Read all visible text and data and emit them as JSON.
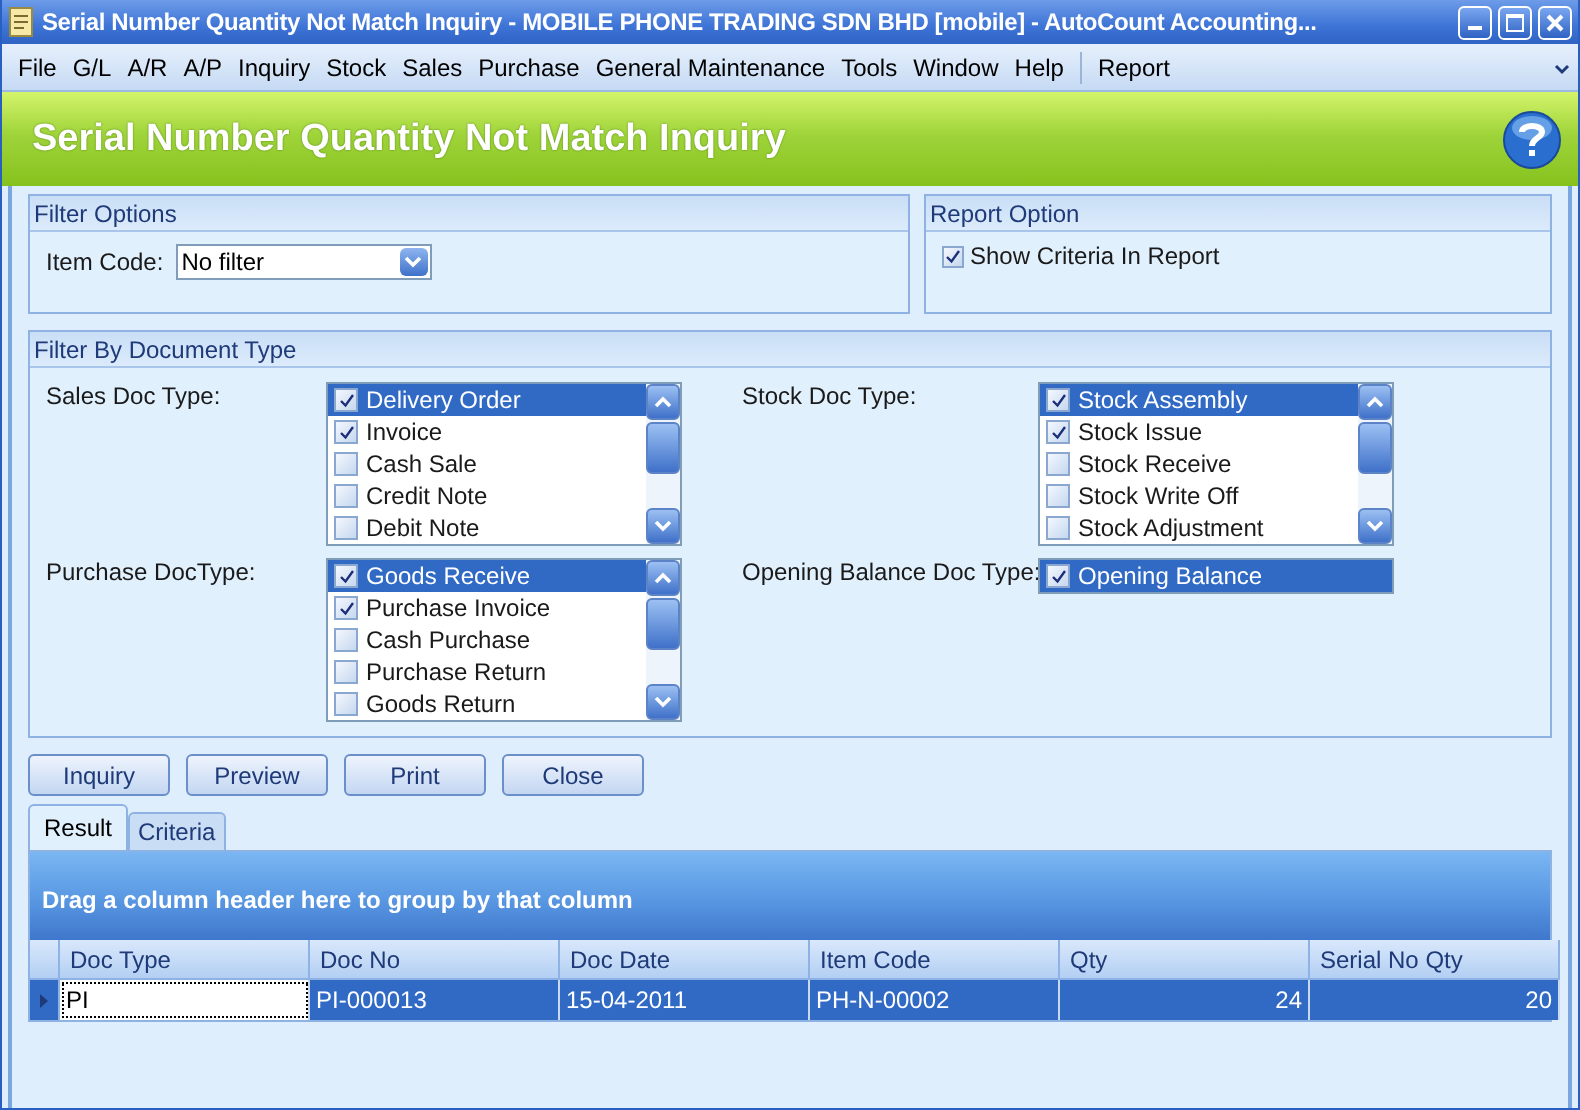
{
  "window": {
    "title": "Serial Number Quantity Not Match Inquiry - MOBILE PHONE TRADING SDN BHD [mobile] - AutoCount Accounting..."
  },
  "menu": [
    {
      "label": "File"
    },
    {
      "label": "G/L"
    },
    {
      "label": "A/R"
    },
    {
      "label": "A/P"
    },
    {
      "label": "Inquiry"
    },
    {
      "label": "Stock"
    },
    {
      "label": "Sales"
    },
    {
      "label": "Purchase"
    },
    {
      "label": "General Maintenance"
    },
    {
      "label": "Tools"
    },
    {
      "label": "Window"
    },
    {
      "label": "Help"
    },
    {
      "label": "Report"
    }
  ],
  "header": {
    "title": "Serial Number Quantity Not Match Inquiry"
  },
  "filter_options": {
    "title": "Filter Options",
    "item_code": {
      "label": "Item Code:",
      "value": "No filter"
    }
  },
  "report_option": {
    "title": "Report Option",
    "show_criteria": {
      "label": "Show Criteria In Report",
      "checked": true
    }
  },
  "doc_type": {
    "title": "Filter By Document Type",
    "groups": [
      {
        "label": "Sales Doc Type:",
        "items": [
          {
            "label": "Delivery Order",
            "checked": true,
            "selected": true
          },
          {
            "label": "Invoice",
            "checked": true,
            "selected": false
          },
          {
            "label": "Cash Sale",
            "checked": false,
            "selected": false
          },
          {
            "label": "Credit Note",
            "checked": false,
            "selected": false
          },
          {
            "label": "Debit Note",
            "checked": false,
            "selected": false
          }
        ]
      },
      {
        "label": "Stock Doc Type:",
        "items": [
          {
            "label": "Stock Assembly",
            "checked": true,
            "selected": true
          },
          {
            "label": "Stock Issue",
            "checked": true,
            "selected": false
          },
          {
            "label": "Stock Receive",
            "checked": false,
            "selected": false
          },
          {
            "label": "Stock Write Off",
            "checked": false,
            "selected": false
          },
          {
            "label": "Stock Adjustment",
            "checked": false,
            "selected": false
          }
        ]
      },
      {
        "label": "Purchase DocType:",
        "items": [
          {
            "label": "Goods Receive",
            "checked": true,
            "selected": true
          },
          {
            "label": "Purchase Invoice",
            "checked": true,
            "selected": false
          },
          {
            "label": "Cash Purchase",
            "checked": false,
            "selected": false
          },
          {
            "label": "Purchase Return",
            "checked": false,
            "selected": false
          },
          {
            "label": "Goods Return",
            "checked": false,
            "selected": false
          }
        ]
      },
      {
        "label": "Opening Balance Doc Type:",
        "items": [
          {
            "label": "Opening Balance",
            "checked": true,
            "selected": true
          }
        ]
      }
    ]
  },
  "buttons": [
    "Inquiry",
    "Preview",
    "Print",
    "Close"
  ],
  "tabs": [
    {
      "label": "Result",
      "selected": true
    },
    {
      "label": "Criteria",
      "selected": false
    }
  ],
  "grid": {
    "group_hint": "Drag a column header here to group by that column",
    "columns": [
      {
        "label": "Doc Type",
        "kind": "text"
      },
      {
        "label": "Doc No",
        "kind": "text"
      },
      {
        "label": "Doc Date",
        "kind": "text"
      },
      {
        "label": "Item Code",
        "kind": "text"
      },
      {
        "label": "Qty",
        "kind": "number"
      },
      {
        "label": "Serial No Qty",
        "kind": "number"
      }
    ],
    "rows": [
      {
        "selected": true,
        "cells": [
          "PI",
          "PI-000013",
          "15-04-2011",
          "PH-N-00002",
          "24",
          "20"
        ]
      }
    ]
  }
}
